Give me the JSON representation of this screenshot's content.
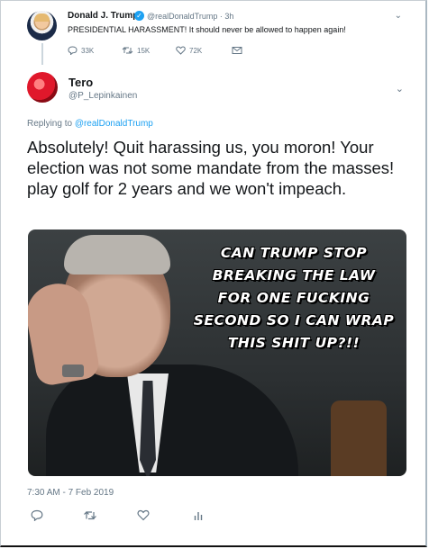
{
  "parent_tweet": {
    "author_name": "Donald J. Trump",
    "verified_glyph": "✓",
    "handle_time": "@realDonaldTrump · 3h",
    "text": "PRESIDENTIAL HARASSMENT! It should never be allowed to happen again!",
    "chevron_glyph": "⌄",
    "actions": {
      "reply_count": "33K",
      "retweet_count": "15K",
      "like_count": "72K"
    }
  },
  "tweet": {
    "author_name": "Tero",
    "handle": "@P_Lepinkainen",
    "chevron_glyph": "⌄",
    "replying_prefix": "Replying to",
    "replying_to": "@realDonaldTrump",
    "text": "Absolutely! Quit harassing us, you moron! Your election was not some mandate from the masses! play golf for 2 years and we won't impeach.",
    "meme_text_lines": [
      "CAN TRUMP STOP",
      "BREAKING THE LAW",
      "FOR ONE FUCKING",
      "SECOND SO I CAN WRAP",
      "THIS SHIT UP?!!"
    ],
    "timestamp": "7:30 AM - 7 Feb 2019"
  },
  "icons": {
    "reply": "reply-icon",
    "retweet": "retweet-icon",
    "like": "heart-icon",
    "message": "envelope-icon",
    "analytics": "analytics-icon"
  },
  "colors": {
    "accent": "#1da1f2",
    "muted": "#657786",
    "text": "#14171a"
  }
}
